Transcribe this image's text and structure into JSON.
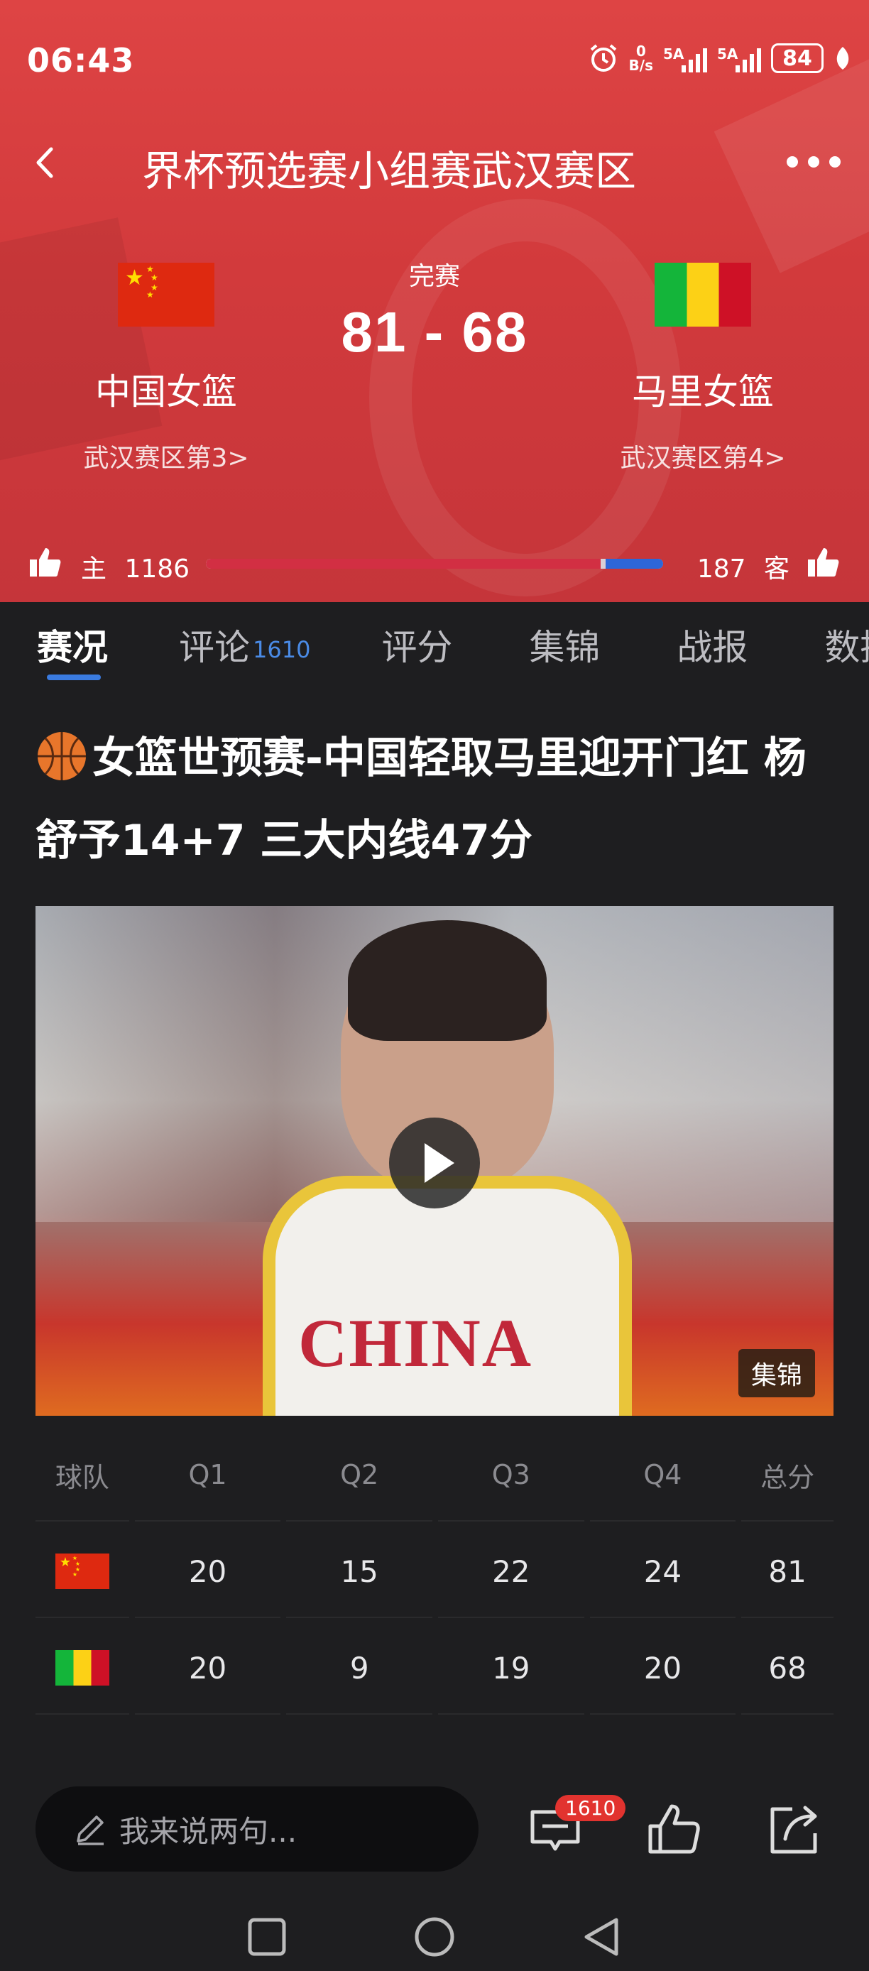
{
  "status_bar": {
    "time": "06:43",
    "net_speed_value": "0",
    "net_speed_unit": "B/s",
    "signal1": "5A",
    "signal2": "5A",
    "battery": "84"
  },
  "nav": {
    "title": "界杯预选赛小组赛武汉赛区"
  },
  "match": {
    "state": "完赛",
    "score": "81 - 68",
    "home": {
      "name": "中国女篮",
      "rank": "武汉赛区第3>"
    },
    "away": {
      "name": "马里女篮",
      "rank": "武汉赛区第4>"
    }
  },
  "support": {
    "home_label": "主",
    "home_count": "1186",
    "away_count": "187",
    "away_label": "客",
    "home_fraction": 0.864
  },
  "tabs": [
    {
      "label": "赛况",
      "active": true
    },
    {
      "label": "评论",
      "count": "1610"
    },
    {
      "label": "评分"
    },
    {
      "label": "集锦"
    },
    {
      "label": "战报"
    },
    {
      "label": "数据"
    }
  ],
  "article": {
    "headline": "女篮世预赛-中国轻取马里迎开门红 杨舒予14+7 三大内线47分",
    "video_tag": "集锦",
    "video_jersey_text": "CHINA"
  },
  "score_table": {
    "headers": [
      "球队",
      "Q1",
      "Q2",
      "Q3",
      "Q4",
      "总分"
    ],
    "rows": [
      {
        "team": "cn",
        "values": [
          "20",
          "15",
          "22",
          "24",
          "81"
        ]
      },
      {
        "team": "ml",
        "values": [
          "20",
          "9",
          "19",
          "20",
          "68"
        ]
      }
    ]
  },
  "bottom_bar": {
    "comment_placeholder": "我来说两句...",
    "comment_badge": "1610"
  },
  "colors": {
    "header_red": "#d23a3c",
    "accent_blue": "#3a7be0",
    "badge_red": "#e2332f"
  }
}
